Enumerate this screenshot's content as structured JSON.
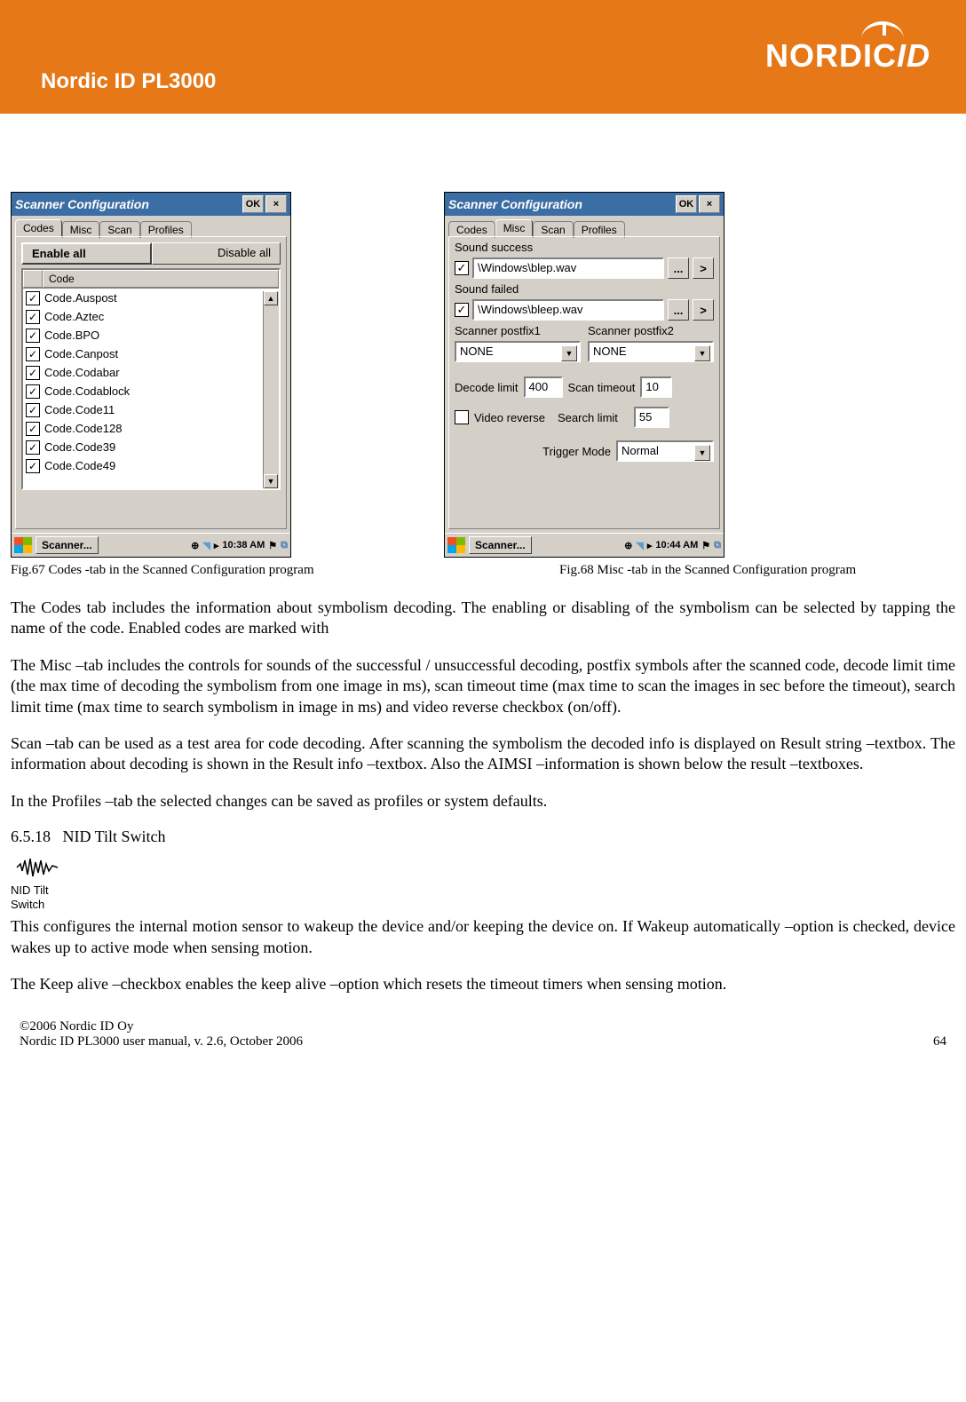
{
  "header": {
    "title": "Nordic ID PL3000",
    "brand_a": "NORDIC",
    "brand_b": "ID"
  },
  "win": {
    "title": "Scanner Configuration",
    "ok": "OK",
    "close": "×",
    "tabs": {
      "codes": "Codes",
      "misc": "Misc",
      "scan": "Scan",
      "profiles": "Profiles"
    },
    "enable_all": "Enable all",
    "disable_all": "Disable all",
    "col_code": "Code",
    "codes": [
      "Code.Auspost",
      "Code.Aztec",
      "Code.BPO",
      "Code.Canpost",
      "Code.Codabar",
      "Code.Codablock",
      "Code.Code11",
      "Code.Code128",
      "Code.Code39",
      "Code.Code49"
    ],
    "task_app": "Scanner...",
    "time1": "10:38 AM",
    "time2": "10:44 AM"
  },
  "misc": {
    "sound_success_lbl": "Sound success",
    "sound_success_val": "\\Windows\\blep.wav",
    "sound_failed_lbl": "Sound failed",
    "sound_failed_val": "\\Windows\\bleep.wav",
    "postfix1_lbl": "Scanner postfix1",
    "postfix2_lbl": "Scanner postfix2",
    "postfix1_val": "NONE",
    "postfix2_val": "NONE",
    "decode_limit_lbl": "Decode limit",
    "decode_limit_val": "400",
    "scan_timeout_lbl": "Scan timeout",
    "scan_timeout_val": "10",
    "video_reverse_lbl": "Video reverse",
    "search_limit_lbl": "Search limit",
    "search_limit_val": "55",
    "trigger_mode_lbl": "Trigger Mode",
    "trigger_mode_val": "Normal",
    "browse": "...",
    "play": ">"
  },
  "captions": {
    "c1": "Fig.67 Codes -tab in the Scanned Configuration program",
    "c2": "Fig.68 Misc -tab in the Scanned Configuration program"
  },
  "body": {
    "p1": "The Codes tab includes the information about symbolism decoding.  The enabling or disabling of the symbolism can be selected by tapping the name of the code. Enabled codes are marked with",
    "p2": "The Misc –tab includes the controls for sounds of the successful / unsuccessful decoding, postfix symbols after the scanned code, decode limit time (the max time of decoding the symbolism from one image in ms), scan timeout time (max time to scan the images in sec before the timeout), search limit time (max time to search symbolism in image in ms) and video reverse checkbox (on/off).",
    "p3": "Scan –tab can be used as a test area for code decoding.  After scanning the symbolism the decoded info is displayed on Result string –textbox. The information about decoding is shown in the Result info –textbox. Also the AIMSI –information is shown below the result –textboxes.",
    "p4": "In the Profiles –tab the selected changes can be saved as profiles or system defaults."
  },
  "section": {
    "num": "6.5.18",
    "title": "NID Tilt Switch"
  },
  "tilticon": {
    "label1": "NID Tilt",
    "label2": "Switch"
  },
  "body2": {
    "p5": "This configures the internal motion sensor to wakeup the device and/or keeping the device on. If Wakeup automatically –option is checked, device wakes up to active mode when sensing motion.",
    "p6": "The Keep alive –checkbox enables the keep alive –option which resets the timeout timers when sensing motion."
  },
  "footer": {
    "c1": "©2006 Nordic ID Oy",
    "c2": "Nordic ID PL3000 user manual, v. 2.6, October 2006",
    "page": "64"
  }
}
